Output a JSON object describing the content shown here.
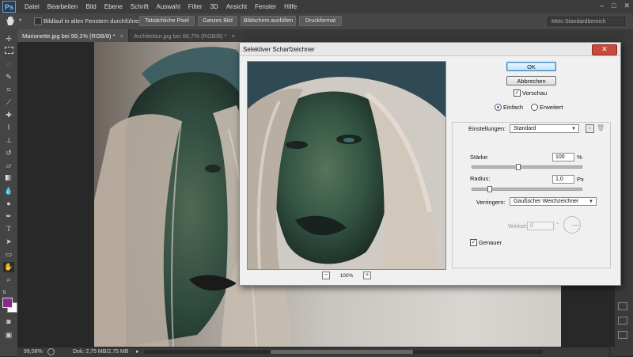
{
  "app": {
    "logo": "Ps",
    "menu": [
      "Datei",
      "Bearbeiten",
      "Bild",
      "Ebene",
      "Schrift",
      "Auswahl",
      "Filter",
      "3D",
      "Ansicht",
      "Fenster",
      "Hilfe"
    ],
    "window_controls": [
      "–",
      "□",
      "✕"
    ]
  },
  "options_bar": {
    "scroll_all_label": "Bildlauf in allen Fenstern durchführen",
    "buttons": [
      "Tatsächliche Pixel",
      "Ganzes Bild",
      "Bildschirm ausfüllen",
      "Druckformat"
    ],
    "workspace": "Mein Standardbereich"
  },
  "tabs": [
    {
      "label": "Marionette.jpg bei 99,1% (RGB/8) *",
      "close": "×"
    },
    {
      "label": "Architektur.jpg bei 66,7% (RGB/8) *",
      "close": "×"
    }
  ],
  "status": {
    "zoom": "99,08%",
    "doc": "Dok: 2,75 MB/2,75 MB"
  },
  "dialog": {
    "title": "Selektiver Scharfzeichner",
    "close": "✕",
    "ok": "OK",
    "cancel": "Abbrechen",
    "preview_label": "Vorschau",
    "preview_checked": "✓",
    "mode_basic": "Einfach",
    "mode_advanced": "Erweitert",
    "zoom": "100%",
    "zoom_minus": "−",
    "zoom_plus": "+",
    "settings_label": "Einstellungen:",
    "settings_value": "Standard",
    "amount_label": "Stärke:",
    "amount_value": "100",
    "amount_unit": "%",
    "radius_label": "Radius:",
    "radius_value": "1,0",
    "radius_unit": "Px",
    "remove_label": "Verringern:",
    "remove_value": "Gaußscher Weichzeichner",
    "angle_label": "Winkel:",
    "angle_value": "0",
    "angle_unit": "°",
    "precise_label": "Genauer",
    "precise_checked": "✓",
    "amount_level": 0.42,
    "radius_level": 0.16
  },
  "colors": {
    "foreground": "#8a2a8c",
    "background": "#ffffff"
  }
}
